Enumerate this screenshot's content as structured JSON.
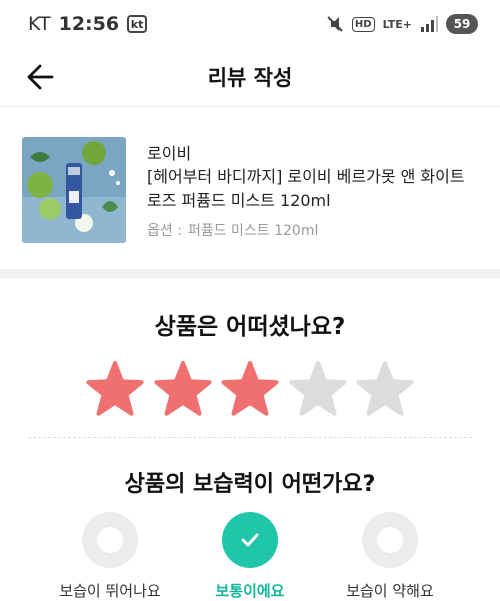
{
  "status_bar": {
    "carrier": "KT",
    "time": "12:56",
    "carrier_badge": "kt",
    "hd_label": "HD",
    "network": "LTE+",
    "battery": "59"
  },
  "header": {
    "title": "리뷰 작성"
  },
  "product": {
    "brand": "로이비",
    "name": "[헤어부터 바디까지] 로이비 베르가못 앤 화이트로즈 퍼퓸드 미스트 120ml",
    "option_label": "옵션 :",
    "option_value": "퍼퓸드 미스트 120ml"
  },
  "rating": {
    "question": "상품은 어떠셨나요?",
    "value": 3,
    "max": 5,
    "filled_color": "#f07070",
    "empty_color": "#dcdcdc"
  },
  "moisture": {
    "question": "상품의 보습력이 어떤가요?",
    "selected_index": 1,
    "options": [
      {
        "label": "보습이 뛰어나요"
      },
      {
        "label": "보통이에요"
      },
      {
        "label": "보습이 약해요"
      }
    ],
    "accent": "#1fc6aa"
  }
}
